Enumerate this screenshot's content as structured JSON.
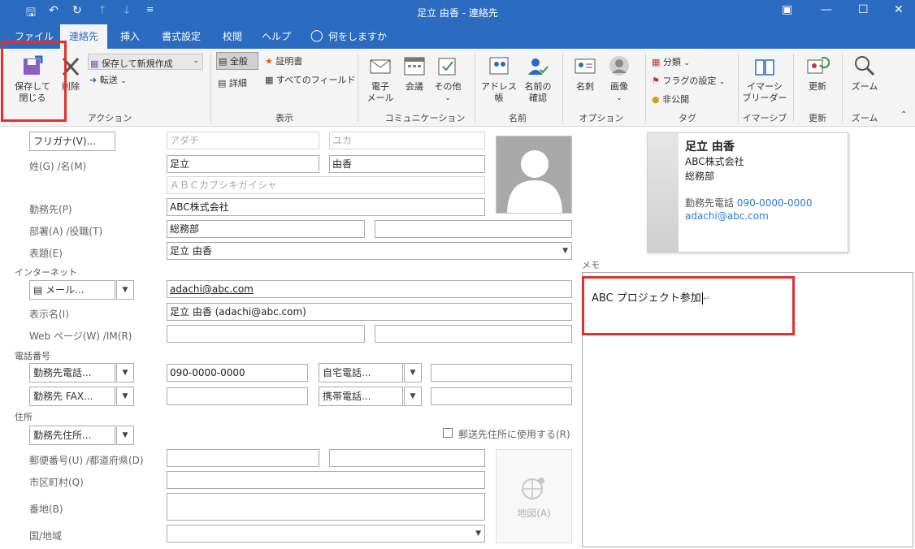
{
  "window": {
    "title": "足立 由香 - 連絡先",
    "qa_icons": [
      "save-icon",
      "undo-icon",
      "redo-icon",
      "up-icon",
      "down-icon",
      "customize-icon"
    ]
  },
  "tabs": [
    "ファイル",
    "連絡先",
    "挿入",
    "書式設定",
    "校閲",
    "ヘルプ"
  ],
  "tell_me": "何をしますか",
  "ribbon": {
    "save_close": "保存して\n閉じる",
    "delete": "削除",
    "save_new": "保存して新規作成",
    "forward": "転送",
    "group_action": "アクション",
    "general": "全般",
    "details": "詳細",
    "certificates": "証明書",
    "all_fields": "すべてのフィールド",
    "group_show": "表示",
    "email": "電子\nメール",
    "meeting": "会議",
    "more": "その他",
    "group_comm": "コミュニケーション",
    "address_book": "アドレス帳",
    "check_names": "名前の\n確認",
    "group_names": "名前",
    "business_card": "名刺",
    "picture": "画像",
    "group_options": "オプション",
    "categorize": "分類",
    "follow_up": "フラグの設定",
    "private": "非公開",
    "group_tags": "タグ",
    "immersive_reader": "イマーシ\nブリーダー",
    "group_immersive": "イマーシブ",
    "update": "更新",
    "group_update": "更新",
    "zoom": "ズーム",
    "group_zoom": "ズーム"
  },
  "form": {
    "furigana_btn": "フリガナ(V)...",
    "furigana_last": "アダチ",
    "furigana_first": "ユカ",
    "name_label": "姓(G)  /名(M)",
    "last_name": "足立",
    "first_name": "由香",
    "company_furigana": "ＡＢＣカブシキガイシャ",
    "company_label": "勤務先(P)",
    "company": "ABC株式会社",
    "dept_label": "部署(A)  /役職(T)",
    "department": "総務部",
    "job_title": "",
    "file_as_label": "表題(E)",
    "file_as": "足立 由香",
    "internet_section": "インターネット",
    "email_btn": "メール...",
    "email": "adachi@abc.com",
    "display_name_label": "表示名(I)",
    "display_name": "足立 由香 (adachi@abc.com)",
    "web_label": "Web ページ(W)  /IM(R)",
    "web": "",
    "im": "",
    "phone_section": "電話番号",
    "business_phone_btn": "勤務先電話...",
    "business_phone": "090-0000-0000",
    "home_phone_btn": "自宅電話...",
    "home_phone": "",
    "business_fax_btn": "勤務先 FAX...",
    "business_fax": "",
    "mobile_btn": "携帯電話...",
    "mobile": "",
    "address_section": "住所",
    "business_address_btn": "勤務先住所...",
    "mailing_checkbox": "郵送先住所に使用する(R)",
    "zip_label": "郵便番号(U)  /都道府県(D)",
    "city_label": "市区町村(Q)",
    "street_label": "番地(B)",
    "country_label": "国/地域",
    "map_btn": "地図(A)"
  },
  "card": {
    "name": "足立 由香",
    "company": "ABC株式会社",
    "dept": "総務部",
    "phone_label": "勤務先電話",
    "phone": "090-0000-0000",
    "email": "adachi@abc.com"
  },
  "notes": {
    "label": "メモ",
    "text": "ABC プロジェクト参加"
  },
  "colors": {
    "accent": "#2b6cc0",
    "highlight": "#e03030"
  }
}
